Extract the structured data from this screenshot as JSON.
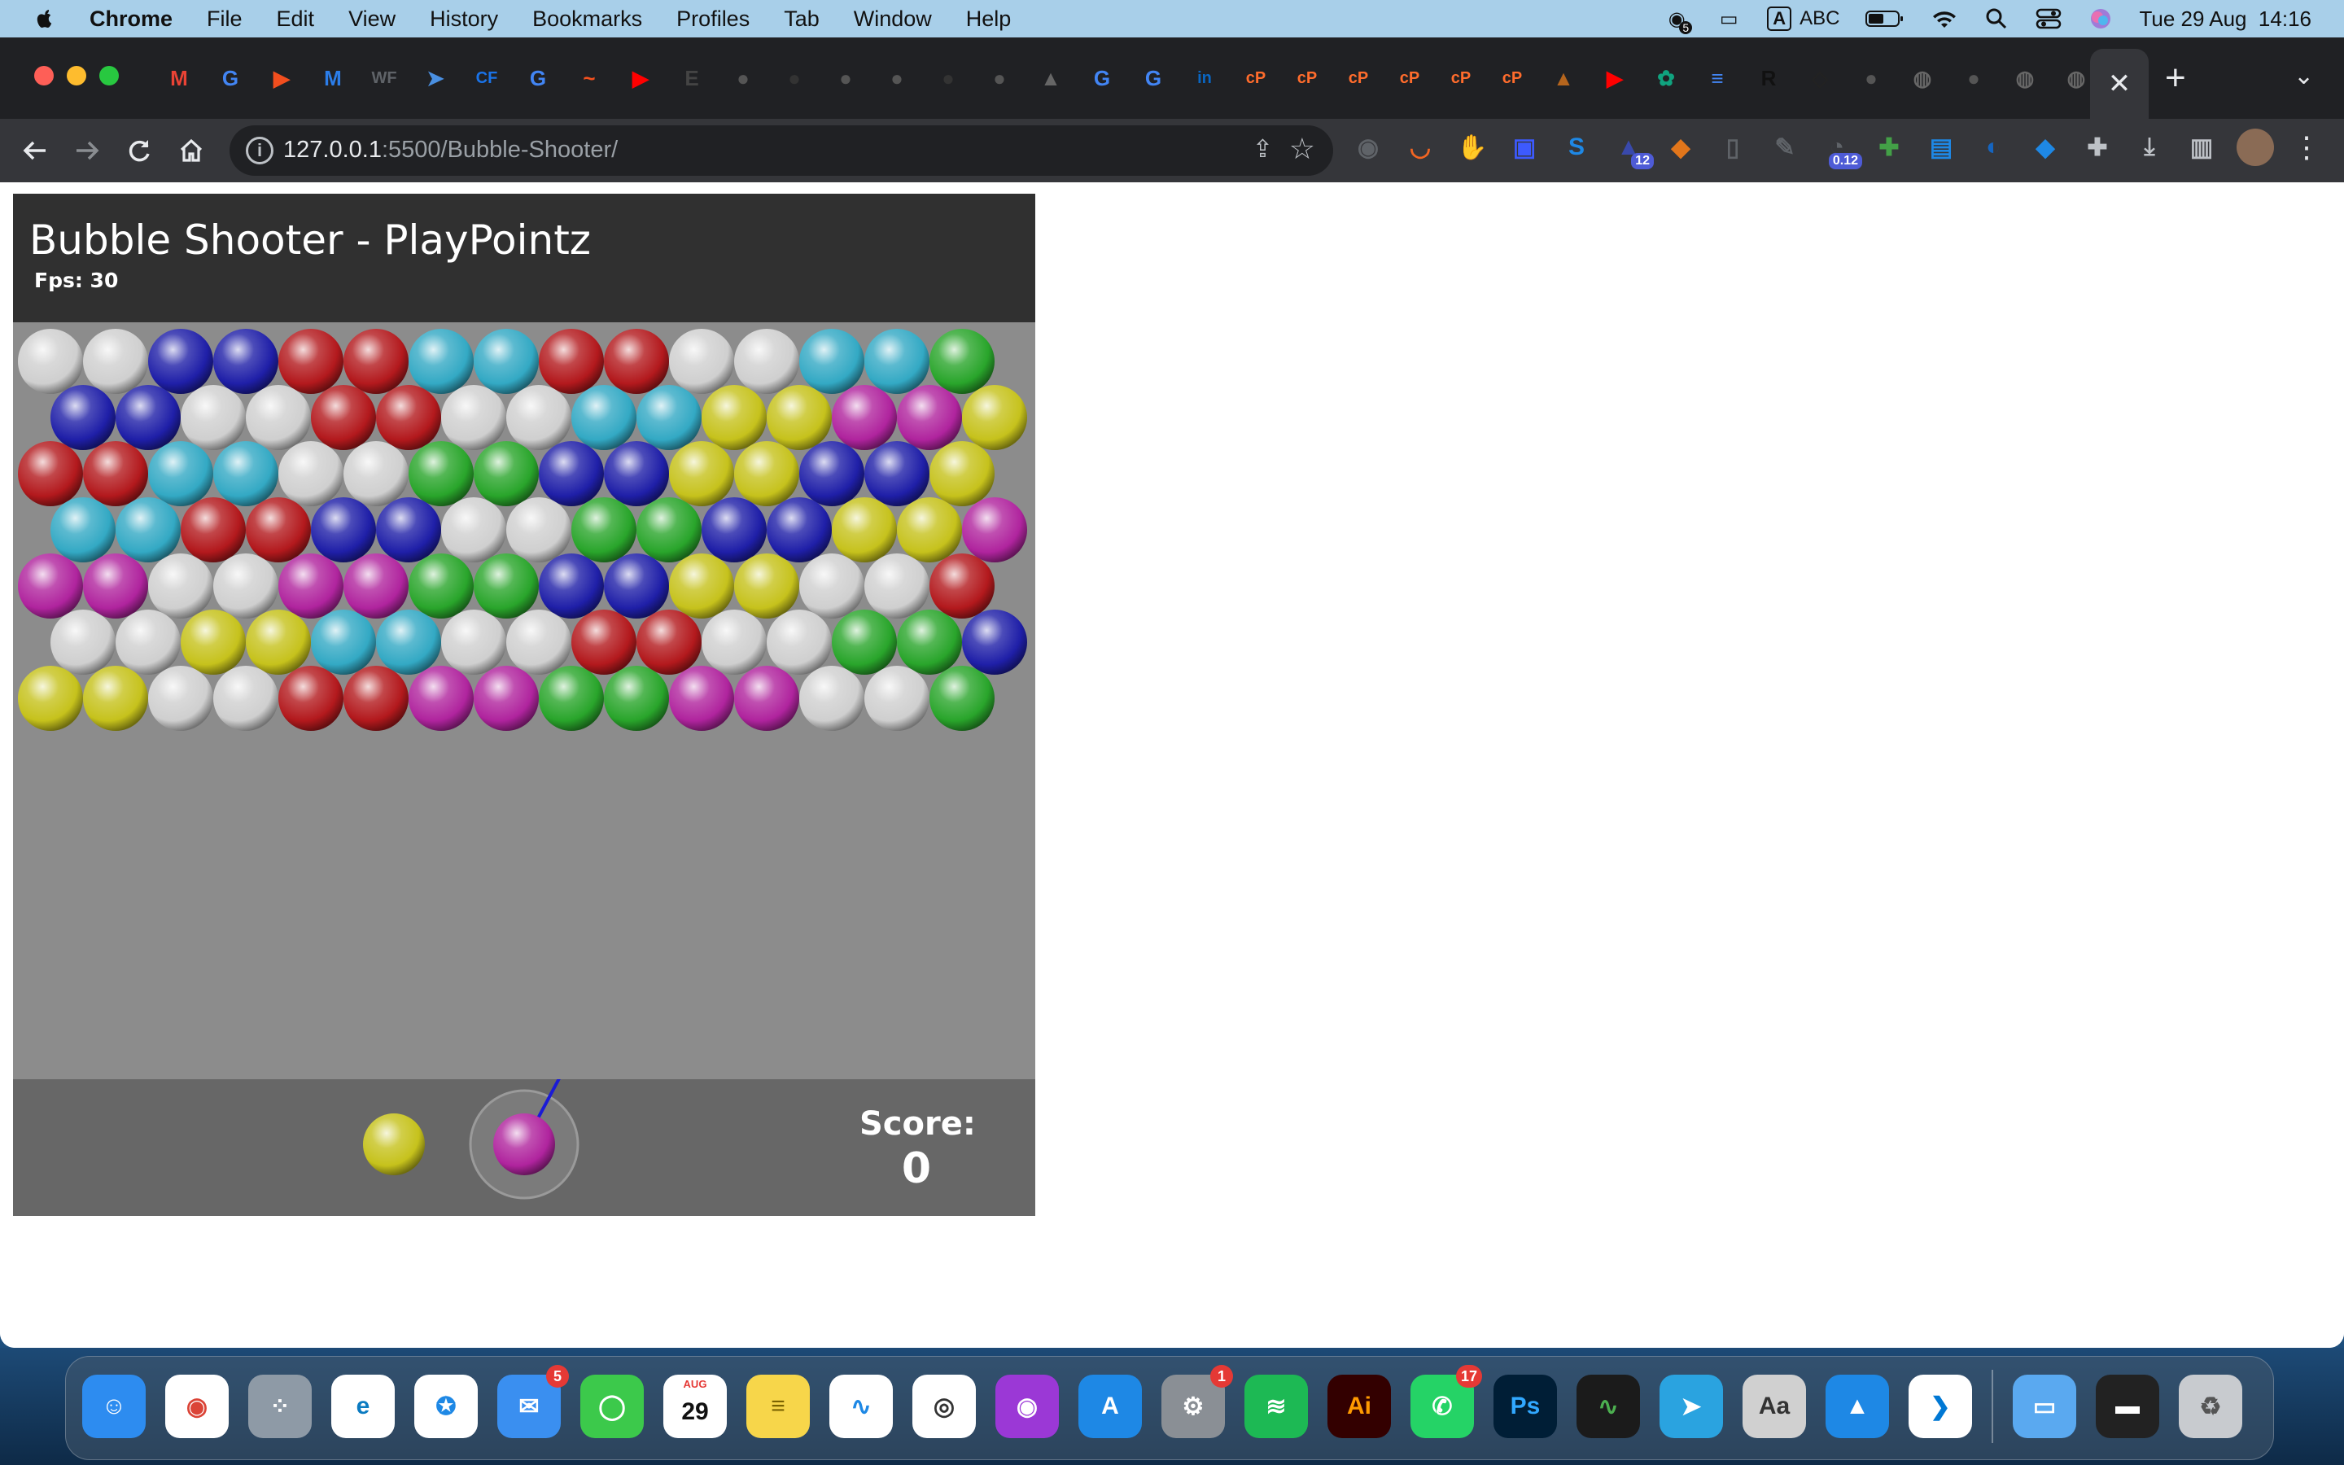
{
  "menubar": {
    "app_name": "Chrome",
    "items": [
      "File",
      "Edit",
      "View",
      "History",
      "Bookmarks",
      "Profiles",
      "Tab",
      "Window",
      "Help"
    ],
    "input_source_box": "A",
    "input_source": "ABC",
    "notification_count": "5",
    "datetime": "Tue 29 Aug  14:16"
  },
  "browser": {
    "url_host": "127.0.0.1",
    "url_path": ":5500/Bubble-Shooter/",
    "tab_favicons": [
      {
        "name": "gmail-icon",
        "glyph": "M",
        "color": "#ea4335"
      },
      {
        "name": "google-icon",
        "glyph": "G",
        "color": "#4285f4"
      },
      {
        "name": "figma-icon",
        "glyph": "▶",
        "color": "#f24e1e"
      },
      {
        "name": "ms-icon",
        "glyph": "M",
        "color": "#2b7de9"
      },
      {
        "name": "webflow-icon",
        "glyph": "WF",
        "color": "#5f6368"
      },
      {
        "name": "flutter-icon",
        "glyph": "➤",
        "color": "#4a90e2"
      },
      {
        "name": "cf-icon",
        "glyph": "CF",
        "color": "#1a73e8"
      },
      {
        "name": "google-icon",
        "glyph": "G",
        "color": "#4285f4"
      },
      {
        "name": "chart-icon",
        "glyph": "~",
        "color": "#f4511e"
      },
      {
        "name": "youtube-icon",
        "glyph": "▶",
        "color": "#ff0000"
      },
      {
        "name": "e-icon",
        "glyph": "E",
        "color": "#444"
      },
      {
        "name": "github-icon",
        "glyph": "●",
        "color": "#555"
      },
      {
        "name": "github-icon",
        "glyph": "●",
        "color": "#333"
      },
      {
        "name": "github-icon",
        "glyph": "●",
        "color": "#555"
      },
      {
        "name": "github-icon",
        "glyph": "●",
        "color": "#555"
      },
      {
        "name": "github-icon",
        "glyph": "●",
        "color": "#333"
      },
      {
        "name": "github-icon",
        "glyph": "●",
        "color": "#555"
      },
      {
        "name": "bird-icon",
        "glyph": "▲",
        "color": "#666"
      },
      {
        "name": "google-icon",
        "glyph": "G",
        "color": "#4285f4"
      },
      {
        "name": "google-icon",
        "glyph": "G",
        "color": "#4285f4"
      },
      {
        "name": "linkedin-icon",
        "glyph": "in",
        "color": "#0a66c2"
      },
      {
        "name": "cp-icon",
        "glyph": "cP",
        "color": "#ff6c2c"
      },
      {
        "name": "cp-icon",
        "glyph": "cP",
        "color": "#ff6c2c"
      },
      {
        "name": "cp-icon",
        "glyph": "cP",
        "color": "#ff6c2c"
      },
      {
        "name": "cp-icon",
        "glyph": "cP",
        "color": "#ff6c2c"
      },
      {
        "name": "cp-icon",
        "glyph": "cP",
        "color": "#ff6c2c"
      },
      {
        "name": "cp-icon",
        "glyph": "cP",
        "color": "#ff6c2c"
      },
      {
        "name": "mra-icon",
        "glyph": "▲",
        "color": "#b5651d"
      },
      {
        "name": "youtube-icon",
        "glyph": "▶",
        "color": "#ff0000"
      },
      {
        "name": "openai-icon",
        "glyph": "✿",
        "color": "#10a37f"
      },
      {
        "name": "docs-icon",
        "glyph": "≡",
        "color": "#4285f4"
      },
      {
        "name": "r-icon",
        "glyph": "R",
        "color": "#111"
      },
      {
        "name": "codepen-icon",
        "glyph": "◇",
        "color": "#222"
      },
      {
        "name": "github-icon",
        "glyph": "●",
        "color": "#555"
      },
      {
        "name": "globe-icon",
        "glyph": "◍",
        "color": "#666"
      },
      {
        "name": "github-icon",
        "glyph": "●",
        "color": "#555"
      },
      {
        "name": "globe-icon",
        "glyph": "◍",
        "color": "#666"
      },
      {
        "name": "globe-icon",
        "glyph": "◍",
        "color": "#666"
      }
    ],
    "active_tab_close": "✕",
    "new_tab": "+",
    "tab_menu": "⌄",
    "extensions": [
      {
        "name": "camera-ext-icon",
        "color": "#5f6368",
        "glyph": "◉"
      },
      {
        "name": "rss-ext-icon",
        "color": "#f26522",
        "glyph": "◡"
      },
      {
        "name": "stop-ext-icon",
        "color": "#e53935",
        "glyph": "✋"
      },
      {
        "name": "screen-ext-icon",
        "color": "#3d5afe",
        "glyph": "▣"
      },
      {
        "name": "shazam-ext-icon",
        "color": "#1e88e5",
        "glyph": "S"
      },
      {
        "name": "hat-ext-icon",
        "color": "#3949ab",
        "glyph": "▲",
        "badge": "12"
      },
      {
        "name": "metamask-ext-icon",
        "color": "#e2761b",
        "glyph": "◆"
      },
      {
        "name": "mouse-ext-icon",
        "color": "#5f6368",
        "glyph": "▯"
      },
      {
        "name": "edit-ext-icon",
        "color": "#5f6368",
        "glyph": "✎"
      },
      {
        "name": "timer-ext-icon",
        "color": "#5f6368",
        "glyph": "◔",
        "badge": "0.12"
      },
      {
        "name": "puzzle-green-ext-icon",
        "color": "#43a047",
        "glyph": "✚"
      },
      {
        "name": "window-ext-icon",
        "color": "#1e88e5",
        "glyph": "▤"
      },
      {
        "name": "bird-ext-icon",
        "color": "#1565c0",
        "glyph": "◐"
      },
      {
        "name": "shield-ext-icon",
        "color": "#1e88e5",
        "glyph": "◆"
      },
      {
        "name": "puzzle-ext-icon",
        "color": "#bdc1c6",
        "glyph": "✚"
      },
      {
        "name": "download-ext-icon",
        "color": "#bdc1c6",
        "glyph": "⤓"
      },
      {
        "name": "sidepanel-ext-icon",
        "color": "#bdc1c6",
        "glyph": "▥"
      }
    ]
  },
  "game": {
    "title": "Bubble Shooter - PlayPointz",
    "fps": "Fps: 30",
    "score_label": "Score:",
    "score": "0",
    "current_bubble": "magenta",
    "next_bubble": "yellow",
    "aim_angle_deg": 62,
    "colors": {
      "white": "#cfcfcf",
      "blue": "#1f1fa8",
      "red": "#b3191d",
      "cyan": "#33a9c4",
      "green": "#29a52b",
      "yellow": "#c6c21c",
      "magenta": "#b0249e"
    },
    "grid": [
      [
        "white",
        "white",
        "blue",
        "blue",
        "red",
        "red",
        "cyan",
        "cyan",
        "red",
        "red",
        "white",
        "white",
        "cyan",
        "cyan",
        "green"
      ],
      [
        "blue",
        "blue",
        "white",
        "white",
        "red",
        "red",
        "white",
        "white",
        "cyan",
        "cyan",
        "yellow",
        "yellow",
        "magenta",
        "magenta",
        "yellow"
      ],
      [
        "red",
        "red",
        "cyan",
        "cyan",
        "white",
        "white",
        "green",
        "green",
        "blue",
        "blue",
        "yellow",
        "yellow",
        "blue",
        "blue",
        "yellow"
      ],
      [
        "cyan",
        "cyan",
        "red",
        "red",
        "blue",
        "blue",
        "white",
        "white",
        "green",
        "green",
        "blue",
        "blue",
        "yellow",
        "yellow",
        "magenta"
      ],
      [
        "magenta",
        "magenta",
        "white",
        "white",
        "magenta",
        "magenta",
        "green",
        "green",
        "blue",
        "blue",
        "yellow",
        "yellow",
        "white",
        "white",
        "red"
      ],
      [
        "white",
        "white",
        "yellow",
        "yellow",
        "cyan",
        "cyan",
        "white",
        "white",
        "red",
        "red",
        "white",
        "white",
        "green",
        "green",
        "blue"
      ],
      [
        "yellow",
        "yellow",
        "white",
        "white",
        "red",
        "red",
        "magenta",
        "magenta",
        "green",
        "green",
        "magenta",
        "magenta",
        "white",
        "white",
        "green"
      ]
    ]
  },
  "dock": {
    "apps": [
      {
        "name": "finder-dock-icon",
        "color": "#2d8cf0",
        "glyph": "☺"
      },
      {
        "name": "chrome-dock-icon",
        "color": "#ffffff",
        "glyph": "◉",
        "fg": "#db4437"
      },
      {
        "name": "launchpad-dock-icon",
        "color": "#8e9aa6",
        "glyph": "⁘"
      },
      {
        "name": "edge-dock-icon",
        "color": "#ffffff",
        "glyph": "e",
        "fg": "#0b7bc1"
      },
      {
        "name": "safari-dock-icon",
        "color": "#ffffff",
        "glyph": "✪",
        "fg": "#1e88e5"
      },
      {
        "name": "mail-dock-icon",
        "color": "#3a8ff0",
        "glyph": "✉",
        "badge": "5"
      },
      {
        "name": "messages-dock-icon",
        "color": "#3cc94b",
        "glyph": "◯"
      },
      {
        "name": "calendar-dock-icon",
        "color": "#ffffff",
        "glyph": "29",
        "fg": "#111",
        "label_top": "AUG"
      },
      {
        "name": "notes-dock-icon",
        "color": "#f7d64a",
        "glyph": "≡",
        "fg": "#7a6200"
      },
      {
        "name": "freeform-dock-icon",
        "color": "#ffffff",
        "glyph": "∿",
        "fg": "#1e88e5"
      },
      {
        "name": "screenshot-dock-icon",
        "color": "#ffffff",
        "glyph": "◎",
        "fg": "#333"
      },
      {
        "name": "podcasts-dock-icon",
        "color": "#9b38d6",
        "glyph": "◉"
      },
      {
        "name": "appstore-dock-icon",
        "color": "#1e88e5",
        "glyph": "A"
      },
      {
        "name": "settings-dock-icon",
        "color": "#8a8f95",
        "glyph": "⚙",
        "badge": "1"
      },
      {
        "name": "spotify-dock-icon",
        "color": "#1db954",
        "glyph": "≋"
      },
      {
        "name": "illustrator-dock-icon",
        "color": "#330000",
        "glyph": "Ai",
        "fg": "#ff9a00"
      },
      {
        "name": "whatsapp-dock-icon",
        "color": "#25d366",
        "glyph": "✆",
        "badge": "17"
      },
      {
        "name": "photoshop-dock-icon",
        "color": "#001e36",
        "glyph": "Ps",
        "fg": "#31a8ff"
      },
      {
        "name": "activity-monitor-dock-icon",
        "color": "#1b1b1b",
        "glyph": "∿",
        "fg": "#4caf50"
      },
      {
        "name": "telegram-dock-icon",
        "color": "#2aa3e0",
        "glyph": "➤"
      },
      {
        "name": "fontbook-dock-icon",
        "color": "#d0d0d0",
        "glyph": "Aa",
        "fg": "#333"
      },
      {
        "name": "keynote-dock-icon",
        "color": "#1e88e5",
        "glyph": "▲"
      },
      {
        "name": "vscode-dock-icon",
        "color": "#ffffff",
        "glyph": "❯",
        "fg": "#0078d4"
      }
    ],
    "folders": [
      {
        "name": "downloads-folder-dock-icon",
        "color": "#5aa9f0",
        "glyph": "▭"
      },
      {
        "name": "screen-recording-dock-icon",
        "color": "#222222",
        "glyph": "▬"
      },
      {
        "name": "trash-dock-icon",
        "color": "#c8cbcf",
        "glyph": "♻",
        "fg": "#555"
      }
    ]
  }
}
